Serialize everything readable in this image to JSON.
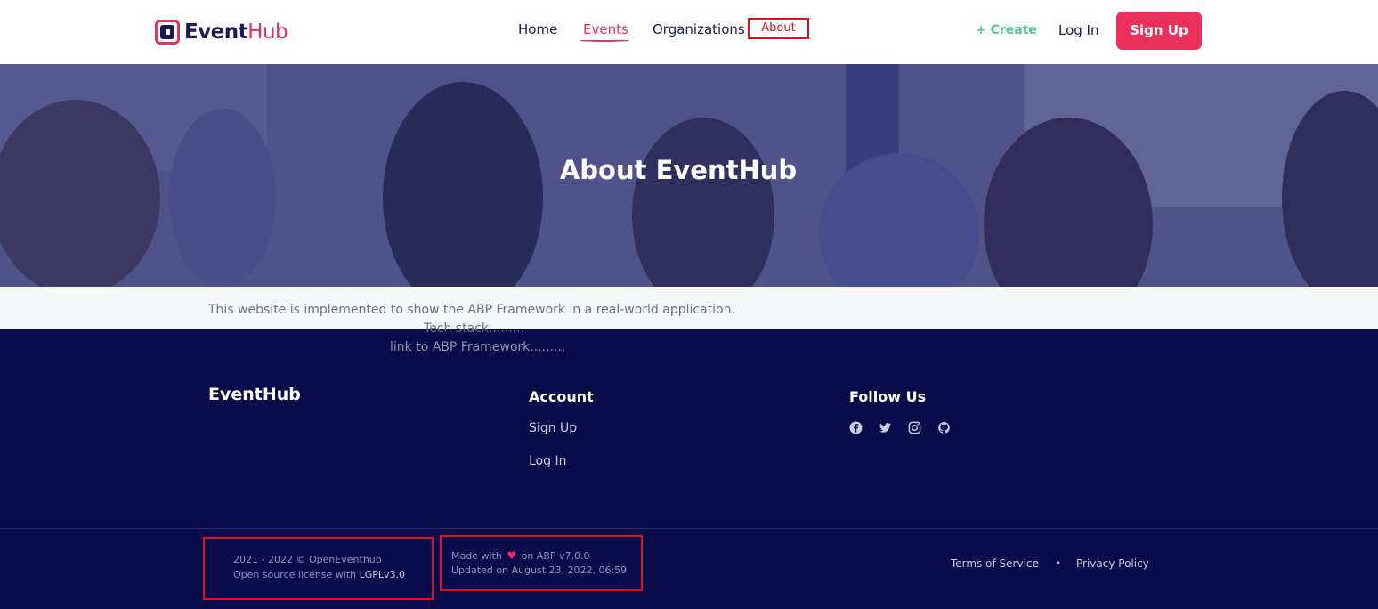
{
  "brand": {
    "name_part1": "Event",
    "name_part2": "Hub"
  },
  "nav": {
    "home": "Home",
    "events": "Events",
    "organizations": "Organizations",
    "about": "About",
    "create": "+ Create",
    "login": "Log In",
    "signup": "Sign Up"
  },
  "hero": {
    "title": "About EventHub"
  },
  "about": {
    "description": "This website is implemented to show the ABP Framework in a real-world application.",
    "tech_stack": "Tech stack.........",
    "abp_link": "link to ABP Framework........."
  },
  "footer": {
    "brand": "EventHub",
    "account_heading": "Account",
    "account_links": [
      "Sign Up",
      "Log In"
    ],
    "follow_heading": "Follow Us",
    "social_icons": [
      "facebook-icon",
      "twitter-icon",
      "instagram-icon",
      "github-icon"
    ],
    "copyright": "2021 - 2022 © OpenEventhub",
    "license_prefix": "Open source license with",
    "license": "LGPLv3.0",
    "made_with": "Made with",
    "made_on": "on ABP v7.0.0",
    "updated": "Updated on August 23, 2022, 06:59",
    "terms": "Terms of Service",
    "separator": "•",
    "privacy": "Privacy Policy"
  },
  "colors": {
    "accent": "#e8305b",
    "navy": "#0a0b4a",
    "create_green": "#50c890",
    "annotation_red": "#e0101a"
  }
}
